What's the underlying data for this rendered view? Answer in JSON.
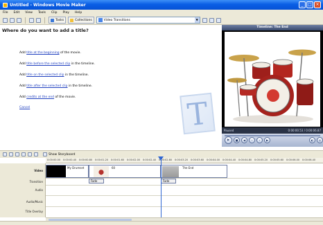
{
  "window": {
    "title": "Untitled - Windows Movie Maker"
  },
  "menu": [
    "File",
    "Edit",
    "View",
    "Tools",
    "Clip",
    "Play",
    "Help"
  ],
  "toolbar": {
    "tasks_label": "Tasks",
    "collections_label": "Collections",
    "dropdown_value": "Video Transitions"
  },
  "content": {
    "heading": "Where do you want to add a title?",
    "options": [
      {
        "pre": "Add ",
        "link": "title at the beginning",
        "post": " of the movie."
      },
      {
        "pre": "Add ",
        "link": "title before the selected clip",
        "post": " in the timeline."
      },
      {
        "pre": "Add ",
        "link": "title on the selected clip",
        "post": " in the timeline."
      },
      {
        "pre": "Add ",
        "link": "title after the selected clip",
        "post": " in the timeline."
      },
      {
        "pre": "Add ",
        "link": "credits at the end",
        "post": " of the movie."
      }
    ],
    "cancel": "Cancel",
    "big_glyph": "T"
  },
  "monitor": {
    "title": "Timeline: The End",
    "status": "Paused",
    "time": "0:00:00.53 / 0:00:06.87",
    "controls": [
      "seek-back",
      "play",
      "stop",
      "prev",
      "next",
      "fullscreen"
    ]
  },
  "timeline_toolbar": {
    "show_storyboard": "Show Storyboard"
  },
  "ruler_ticks": [
    "0:00:00.00",
    "0:00:00.40",
    "0:00:00.80",
    "0:00:01.20",
    "0:00:01.60",
    "0:00:02.00",
    "0:00:02.40",
    "0:00:02.80",
    "0:00:03.20",
    "0:00:03.60",
    "0:00:04.00",
    "0:00:04.40",
    "0:00:04.80",
    "0:00:05.20",
    "0:00:05.60",
    "0:00:06.00",
    "0:00:06.40"
  ],
  "tracks": {
    "video": "Video",
    "transition": "Transition",
    "audio": "Audio",
    "audio_music": "Audio/Music",
    "title_overlay": "Title Overlay"
  },
  "clips": {
    "clip1": "My Drumset",
    "clip2": "60",
    "clip3": "The End",
    "fade": "Fade"
  },
  "colors": {
    "titlebar": "#0a5ee5",
    "playhead": "#2f66d3",
    "link": "#1f3fbf"
  }
}
